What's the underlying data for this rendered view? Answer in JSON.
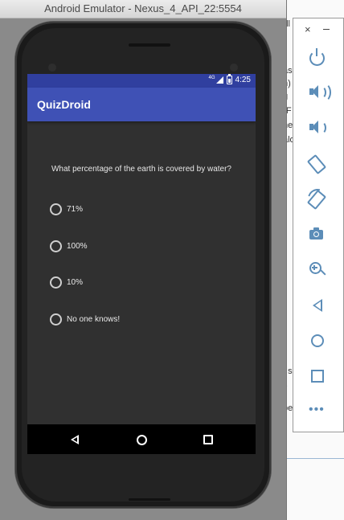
{
  "emulator": {
    "window_title": "Android Emulator - Nexus_4_API_22:5554"
  },
  "status_bar": {
    "network": "4G",
    "time": "4:25"
  },
  "app": {
    "title": "QuizDroid"
  },
  "quiz": {
    "question": "What percentage of the earth is covered by water?",
    "options": [
      {
        "label": "71%",
        "selected": false
      },
      {
        "label": "100%",
        "selected": false
      },
      {
        "label": "10%",
        "selected": false
      },
      {
        "label": "No one knows!",
        "selected": false
      }
    ]
  },
  "nav_bar": {
    "buttons": [
      "back-icon",
      "home-icon",
      "recents-icon"
    ]
  },
  "side_toolbar": {
    "close_label": "×",
    "tools": [
      "power-icon",
      "volume-up-icon",
      "volume-down-icon",
      "rotate-left-icon",
      "rotate-right-icon",
      "camera-icon",
      "zoom-icon",
      "back-icon",
      "home-icon",
      "overview-icon",
      "more-icon"
    ]
  },
  "background_fragments": {
    "f1": "all",
    "f2": "as",
    "f3": "n)",
    "f4": "g",
    "f5": "e",
    "f6": "\"F",
    "f7": "ne",
    "f8": "alo",
    "f9": "t s",
    "f10": "t.",
    "f11": "be"
  },
  "colors": {
    "status_bar": "#303f9f",
    "toolbar": "#3f51b5",
    "screen_bg": "#303030",
    "tool_icon": "#5c8db8"
  }
}
